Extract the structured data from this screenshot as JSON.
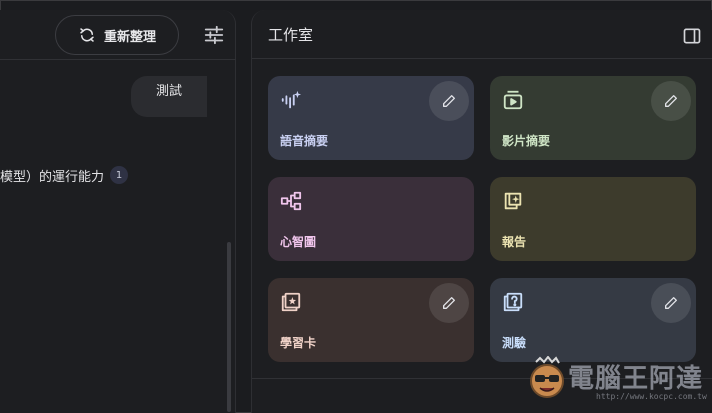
{
  "chat": {
    "refresh_label": "重新整理",
    "user_message": "測試",
    "answer_text": "模型）的運行能力",
    "citation": "1"
  },
  "studio": {
    "title": "工作室",
    "cards": [
      {
        "label": "語音摘要",
        "icon": "audio-sparkle-icon",
        "color": "#363a48"
      },
      {
        "label": "影片摘要",
        "icon": "video-icon",
        "color": "#343b32"
      },
      {
        "label": "心智圖",
        "icon": "mindmap-icon",
        "color": "#3a2f3a"
      },
      {
        "label": "報告",
        "icon": "report-icon",
        "color": "#3d3b2c"
      },
      {
        "label": "學習卡",
        "icon": "flashcard-icon",
        "color": "#3a302f"
      },
      {
        "label": "測驗",
        "icon": "quiz-icon",
        "color": "#353a44"
      }
    ]
  },
  "watermark": {
    "text": "電腦王阿達",
    "url": "http://www.kocpc.com.tw"
  }
}
